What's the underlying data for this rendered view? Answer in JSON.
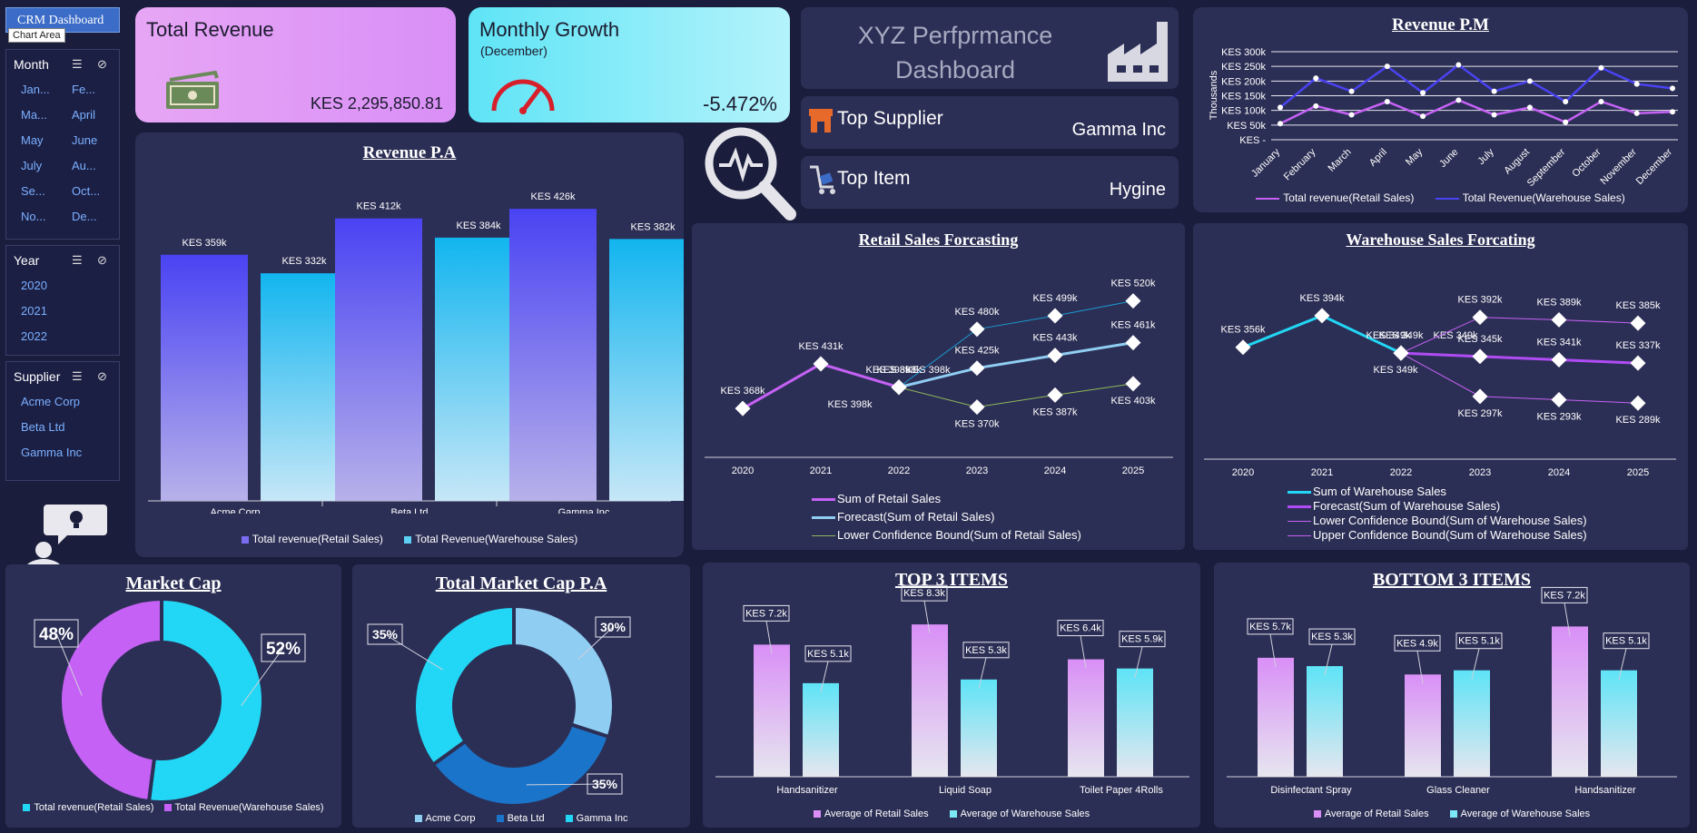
{
  "header": {
    "tag": "CRM Dashboard",
    "tooltip": "Chart Area"
  },
  "slicers": {
    "month": {
      "title": "Month",
      "items": [
        "Jan...",
        "Fe...",
        "Ma...",
        "April",
        "May",
        "June",
        "July",
        "Au...",
        "Se...",
        "Oct...",
        "No...",
        "De..."
      ]
    },
    "year": {
      "title": "Year",
      "items": [
        "2020",
        "2021",
        "2022"
      ]
    },
    "supplier": {
      "title": "Supplier",
      "items": [
        "Acme Corp",
        "Beta Ltd",
        "Gamma Inc"
      ]
    }
  },
  "kpis": {
    "total_revenue": {
      "title": "Total Revenue",
      "value": "KES 2,295,850.81",
      "icon": "money-icon"
    },
    "monthly_growth": {
      "title": "Monthly Growth",
      "subtitle": "(December)",
      "value": "-5.472%",
      "icon": "speedometer-icon"
    }
  },
  "banner": {
    "title_line1": "XYZ Perfprmance",
    "title_line2": "Dashboard",
    "icon": "factory-icon"
  },
  "top_supplier": {
    "label": "Top Supplier",
    "value": "Gamma Inc",
    "icon": "store-icon"
  },
  "top_item": {
    "label": "Top Item",
    "value": "Hygine",
    "icon": "cart-icon"
  },
  "colors": {
    "retail": "#b04cf5",
    "warehouse": "#22d7f5",
    "blue": "#4a43f3",
    "panel": "#2c2f55",
    "bg": "#1a1e3c"
  },
  "chart_data": [
    {
      "id": "revenue_pa",
      "type": "bar",
      "title": "Revenue P.A",
      "categories": [
        "Acme Corp",
        "Beta Ltd",
        "Gamma Inc"
      ],
      "series": [
        {
          "name": "Total revenue(Retail Sales)",
          "values": [
            359,
            412,
            426
          ],
          "labels": [
            "KES 359k",
            "KES 412k",
            "KES 426k"
          ]
        },
        {
          "name": "Total Revenue(Warehouse Sales)",
          "values": [
            332,
            384,
            382
          ],
          "labels": [
            "KES 332k",
            "KES 384k",
            "KES 382k"
          ]
        }
      ],
      "ylim": [
        0,
        450
      ]
    },
    {
      "id": "revenue_pm",
      "type": "line",
      "title": "Revenue P.M",
      "ylabel": "Thousands",
      "yticks": [
        "KES -",
        "KES 50k",
        "KES 100k",
        "KES 150k",
        "KES 200k",
        "KES 250k",
        "KES 300k"
      ],
      "ylim": [
        0,
        300
      ],
      "categories": [
        "January",
        "February",
        "March",
        "April",
        "May",
        "June",
        "July",
        "August",
        "September",
        "October",
        "November",
        "December"
      ],
      "series": [
        {
          "name": "Total revenue(Retail Sales)",
          "values": [
            55,
            115,
            85,
            130,
            80,
            135,
            85,
            110,
            60,
            130,
            90,
            95
          ]
        },
        {
          "name": "Total Revenue(Warehouse Sales)",
          "values": [
            110,
            210,
            165,
            250,
            160,
            255,
            165,
            200,
            130,
            245,
            190,
            175
          ]
        }
      ]
    },
    {
      "id": "retail_forecast",
      "type": "line",
      "title": "Retail Sales Forcasting",
      "categories": [
        "2020",
        "2021",
        "2022",
        "2023",
        "2024",
        "2025"
      ],
      "ylim": [
        340,
        540
      ],
      "series": [
        {
          "name": "Sum of Retail Sales",
          "values": [
            368,
            431,
            398,
            null,
            null,
            null
          ],
          "labels": [
            "KES 368k",
            "KES 431k",
            "KES 398k",
            "",
            "",
            ""
          ]
        },
        {
          "name": "Forecast(Sum of Retail Sales)",
          "values": [
            null,
            null,
            398,
            425,
            443,
            461
          ],
          "labels": [
            "",
            "",
            "KES 398k",
            "KES 425k",
            "KES 443k",
            "KES 461k"
          ]
        },
        {
          "name": "Lower Confidence Bound(Sum of Retail Sales)",
          "values": [
            null,
            null,
            398,
            370,
            387,
            403
          ],
          "labels": [
            "",
            "",
            "KES 398k",
            "KES 370k",
            "KES 387k",
            "KES 403k"
          ]
        },
        {
          "name": "",
          "values": [
            null,
            null,
            398,
            480,
            499,
            520
          ],
          "labels": [
            "",
            "",
            "KES 398k",
            "KES 480k",
            "KES 499k",
            "KES 520k"
          ]
        }
      ]
    },
    {
      "id": "warehouse_forecast",
      "type": "line",
      "title": "Warehouse Sales Forcating",
      "categories": [
        "2020",
        "2021",
        "2022",
        "2023",
        "2024",
        "2025"
      ],
      "ylim": [
        250,
        420
      ],
      "series": [
        {
          "name": "Sum of Warehouse Sales",
          "values": [
            356,
            394,
            349,
            null,
            null,
            null
          ],
          "labels": [
            "KES 356k",
            "KES 394k",
            "KES 349k",
            "",
            "",
            ""
          ]
        },
        {
          "name": "Forecast(Sum of Warehouse Sales)",
          "values": [
            null,
            null,
            349,
            345,
            341,
            337
          ],
          "labels": [
            "",
            "",
            "KES 349k",
            "KES 345k",
            "KES 341k",
            "KES 337k"
          ]
        },
        {
          "name": "Lower Confidence Bound(Sum of Warehouse Sales)",
          "values": [
            null,
            null,
            349,
            297,
            293,
            289
          ],
          "labels": [
            "",
            "",
            "KES 349k",
            "KES 297k",
            "KES 293k",
            "KES 289k"
          ]
        },
        {
          "name": "Upper Confidence Bound(Sum of Warehouse Sales)",
          "values": [
            null,
            null,
            349,
            392,
            389,
            385
          ],
          "labels": [
            "",
            "",
            "KES 349k",
            "KES 392k",
            "KES 389k",
            "KES 385k"
          ]
        }
      ]
    },
    {
      "id": "market_cap",
      "type": "pie",
      "title": "Market Cap",
      "categories": [
        "Total revenue(Retail Sales)",
        "Total Revenue(Warehouse Sales)"
      ],
      "values": [
        48,
        52
      ],
      "labels": [
        "48%",
        "52%"
      ],
      "colors": [
        "#c561f5",
        "#22d7f5"
      ]
    },
    {
      "id": "market_cap_pa",
      "type": "pie",
      "title": "Total Market Cap P.A",
      "categories": [
        "Acme Corp",
        "Beta Ltd",
        "Gamma Inc"
      ],
      "values": [
        30,
        35,
        35
      ],
      "labels": [
        "30%",
        "35%",
        "35%"
      ],
      "colors": [
        "#8fcdf2",
        "#1a74c9",
        "#22d7f5"
      ]
    },
    {
      "id": "top3",
      "type": "bar",
      "title": "TOP 3 ITEMS",
      "categories": [
        "Handsanitizer",
        "Liquid  Soap",
        "Toilet Paper  4Rolls"
      ],
      "series": [
        {
          "name": "Average of Retail Sales",
          "values": [
            7.2,
            8.3,
            6.4
          ],
          "labels": [
            "KES 7.2k",
            "KES 8.3k",
            "KES 6.4k"
          ]
        },
        {
          "name": "Average of Warehouse Sales",
          "values": [
            5.1,
            5.3,
            5.9
          ],
          "labels": [
            "KES 5.1k",
            "KES 5.3k",
            "KES 5.9k"
          ]
        }
      ],
      "ylim": [
        0,
        9
      ]
    },
    {
      "id": "bottom3",
      "type": "bar",
      "title": "BOTTOM 3 ITEMS",
      "categories": [
        "Disinfectant Spray",
        "Glass Cleaner",
        "Handsanitizer"
      ],
      "series": [
        {
          "name": "Average of Retail Sales",
          "values": [
            5.7,
            4.9,
            7.2
          ],
          "labels": [
            "KES 5.7k",
            "KES 4.9k",
            "KES 7.2k"
          ]
        },
        {
          "name": "Average of Warehouse Sales",
          "values": [
            5.3,
            5.1,
            5.1
          ],
          "labels": [
            "KES 5.3k",
            "KES 5.1k",
            "KES 5.1k"
          ]
        }
      ],
      "ylim": [
        0,
        8
      ]
    }
  ]
}
